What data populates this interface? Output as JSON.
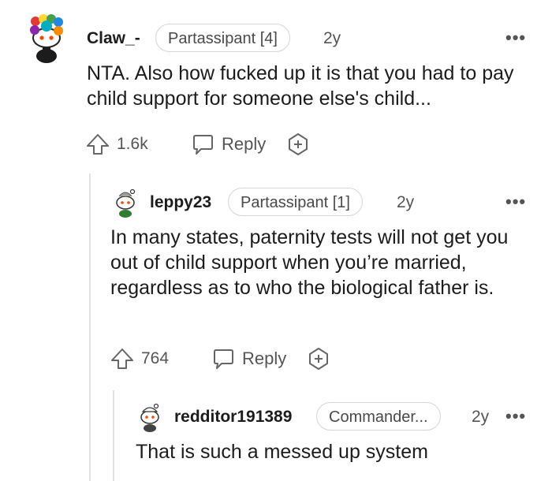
{
  "comments": [
    {
      "username": "Claw_-",
      "flair": "Partassipant [4]",
      "age": "2y",
      "body": "NTA. Also how fucked up it is that you had to pay child support for someone else's child...",
      "votes": "1.6k",
      "reply_label": "Reply",
      "avatar_icon": "snoo-rainbow-avatar-icon"
    },
    {
      "username": "leppy23",
      "flair": "Partassipant [1]",
      "age": "2y",
      "body": "In many states, paternity tests will not get you out of child support when you’re married, regardless as to who the biological father is.",
      "votes": "764",
      "reply_label": "Reply",
      "avatar_icon": "snoo-avatar-icon"
    },
    {
      "username": "redditor191389",
      "flair": "Commander...",
      "age": "2y",
      "body": "That is such a messed up system",
      "avatar_icon": "snoo-avatar-icon"
    }
  ],
  "more_glyph": "•••",
  "colors": {
    "text": "#1c1c1c",
    "meta": "#555555",
    "flair_border": "#d5d5d5",
    "thread_line": "#e2e2e2"
  }
}
